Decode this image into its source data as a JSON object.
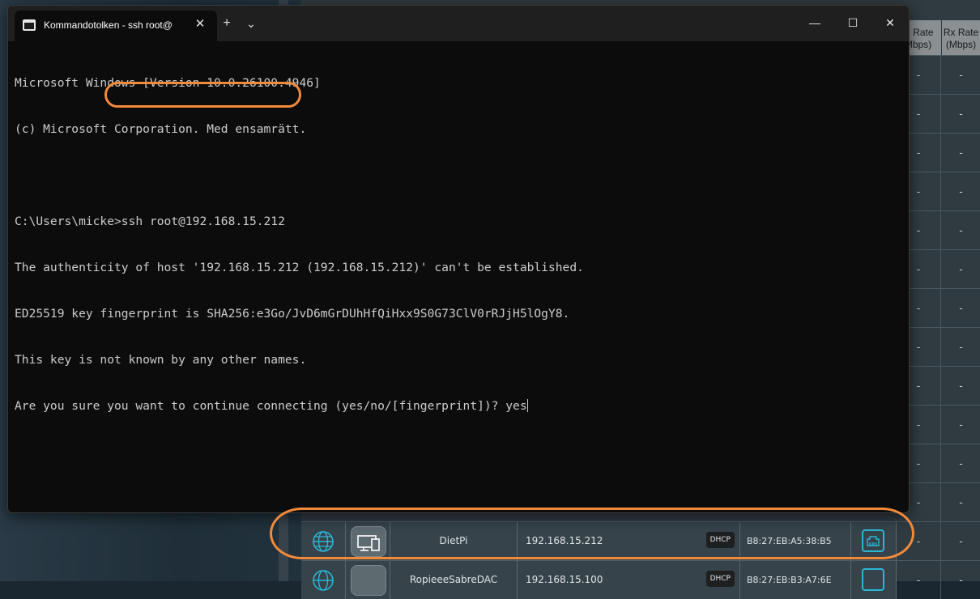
{
  "terminal": {
    "tab_title": "Kommandotolken - ssh  root@",
    "new_tab_glyph": "+",
    "dropdown_glyph": "⌄",
    "close_glyph": "✕",
    "minimize_glyph": "—",
    "maximize_glyph": "☐",
    "lines": [
      "Microsoft Windows [Version 10.0.26100.4946]",
      "(c) Microsoft Corporation. Med ensamrätt.",
      "",
      "C:\\Users\\micke>ssh root@192.168.15.212",
      "The authenticity of host '192.168.15.212 (192.168.15.212)' can't be established.",
      "ED25519 key fingerprint is SHA256:e3Go/JvD6mGrDUhHfQiHxx9S0G73ClV0rRJjH5lOgY8.",
      "This key is not known by any other names.",
      "Are you sure you want to continue connecting (yes/no/[fingerprint])? yes"
    ]
  },
  "router_table": {
    "headers": {
      "tx_rate_line1": "Tx Rate",
      "tx_rate_line2": "(Mbps)",
      "rx_rate_line1": "Rx Rate",
      "rx_rate_line2": "(Mbps)"
    },
    "empty_value": "-",
    "devices": [
      {
        "name": "DietPi",
        "ip": "192.168.15.212",
        "badge": "DHCP",
        "mac": "B8:27:EB:A5:38:B5"
      },
      {
        "name": "RopieeeSabreDAC",
        "ip": "192.168.15.100",
        "badge": "DHCP",
        "mac": "B8:27:EB:B3:A7:6E"
      }
    ]
  },
  "colors": {
    "highlight": "#f28a3a",
    "port_icon": "#2bb6d6",
    "terminal_bg": "#0c0c0c",
    "terminal_text": "#cccccc"
  }
}
